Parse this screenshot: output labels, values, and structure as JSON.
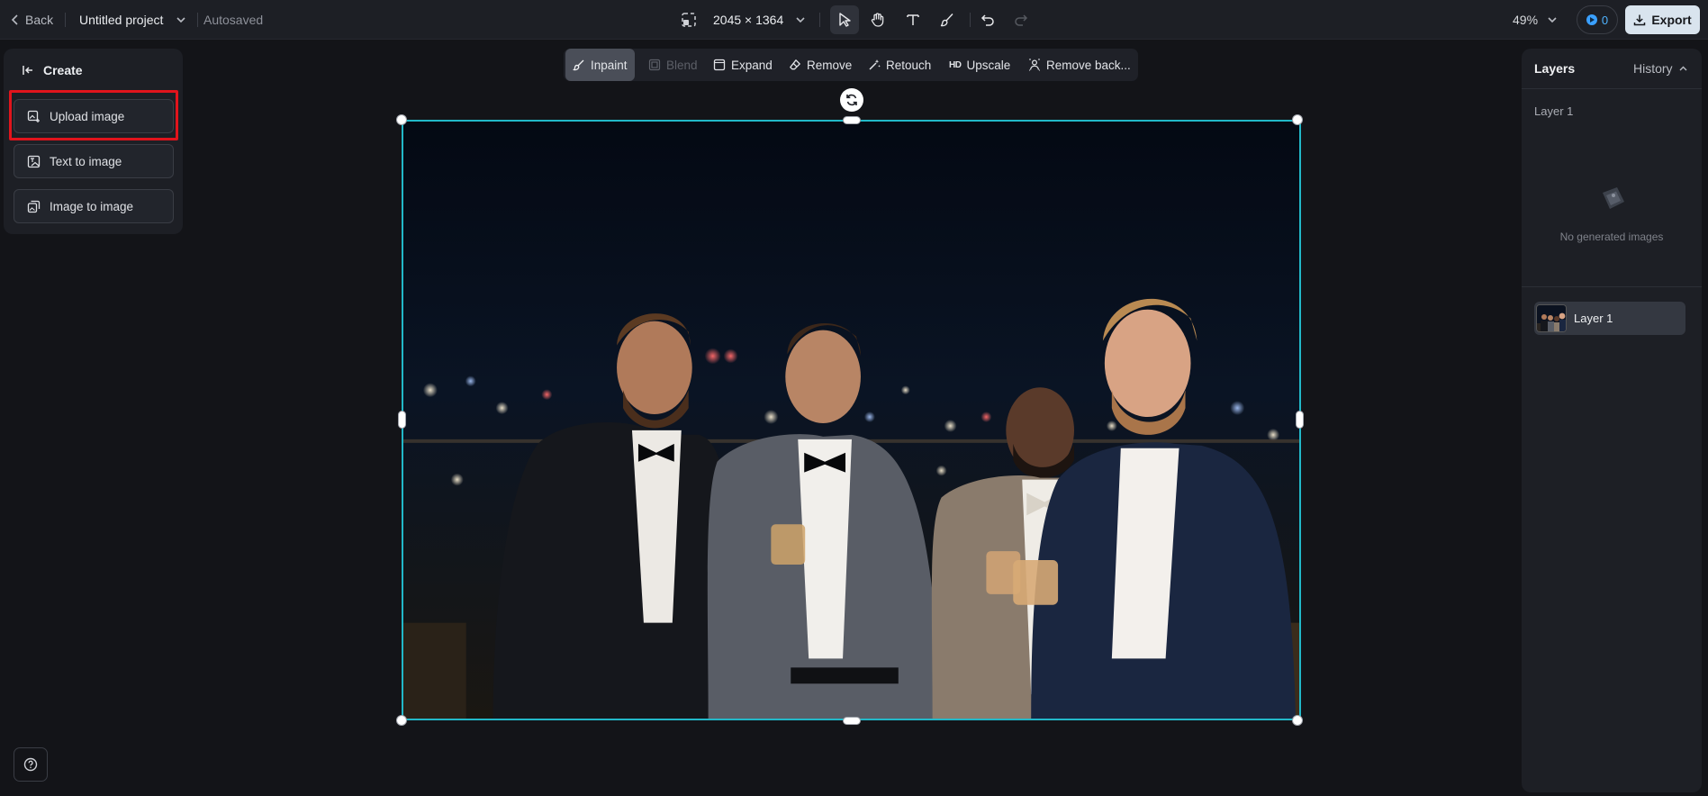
{
  "topbar": {
    "back_label": "Back",
    "project_title": "Untitled project",
    "autosave_status": "Autosaved",
    "canvas_size": "2045 × 1364",
    "zoom": "49%",
    "credits": "0",
    "export_label": "Export"
  },
  "tools": [
    {
      "name": "select-tool",
      "icon": "cursor-icon",
      "active": true
    },
    {
      "name": "hand-tool",
      "icon": "hand-icon",
      "active": false
    },
    {
      "name": "text-tool",
      "icon": "text-icon",
      "active": false
    },
    {
      "name": "brush-tool",
      "icon": "brush-icon",
      "active": false
    },
    {
      "name": "undo-button",
      "icon": "undo-icon",
      "active": false
    },
    {
      "name": "redo-button",
      "icon": "redo-icon",
      "active": false
    }
  ],
  "left_panel": {
    "heading": "Create",
    "buttons": {
      "upload": "Upload image",
      "text_to_image": "Text to image",
      "image_to_image": "Image to image"
    }
  },
  "edit_toolbar": {
    "inpaint": "Inpaint",
    "blend": "Blend",
    "expand": "Expand",
    "remove": "Remove",
    "retouch": "Retouch",
    "upscale_badge": "HD",
    "upscale": "Upscale",
    "remove_background": "Remove back..."
  },
  "right_panel": {
    "layers_tab": "Layers",
    "history_tab": "History",
    "section_title": "Layer 1",
    "empty_message": "No generated images",
    "layers": [
      {
        "name": "Layer 1"
      }
    ]
  },
  "colors": {
    "selection": "#22b8c8",
    "highlight": "#e1141c",
    "export_bg": "#d9e4ee"
  }
}
